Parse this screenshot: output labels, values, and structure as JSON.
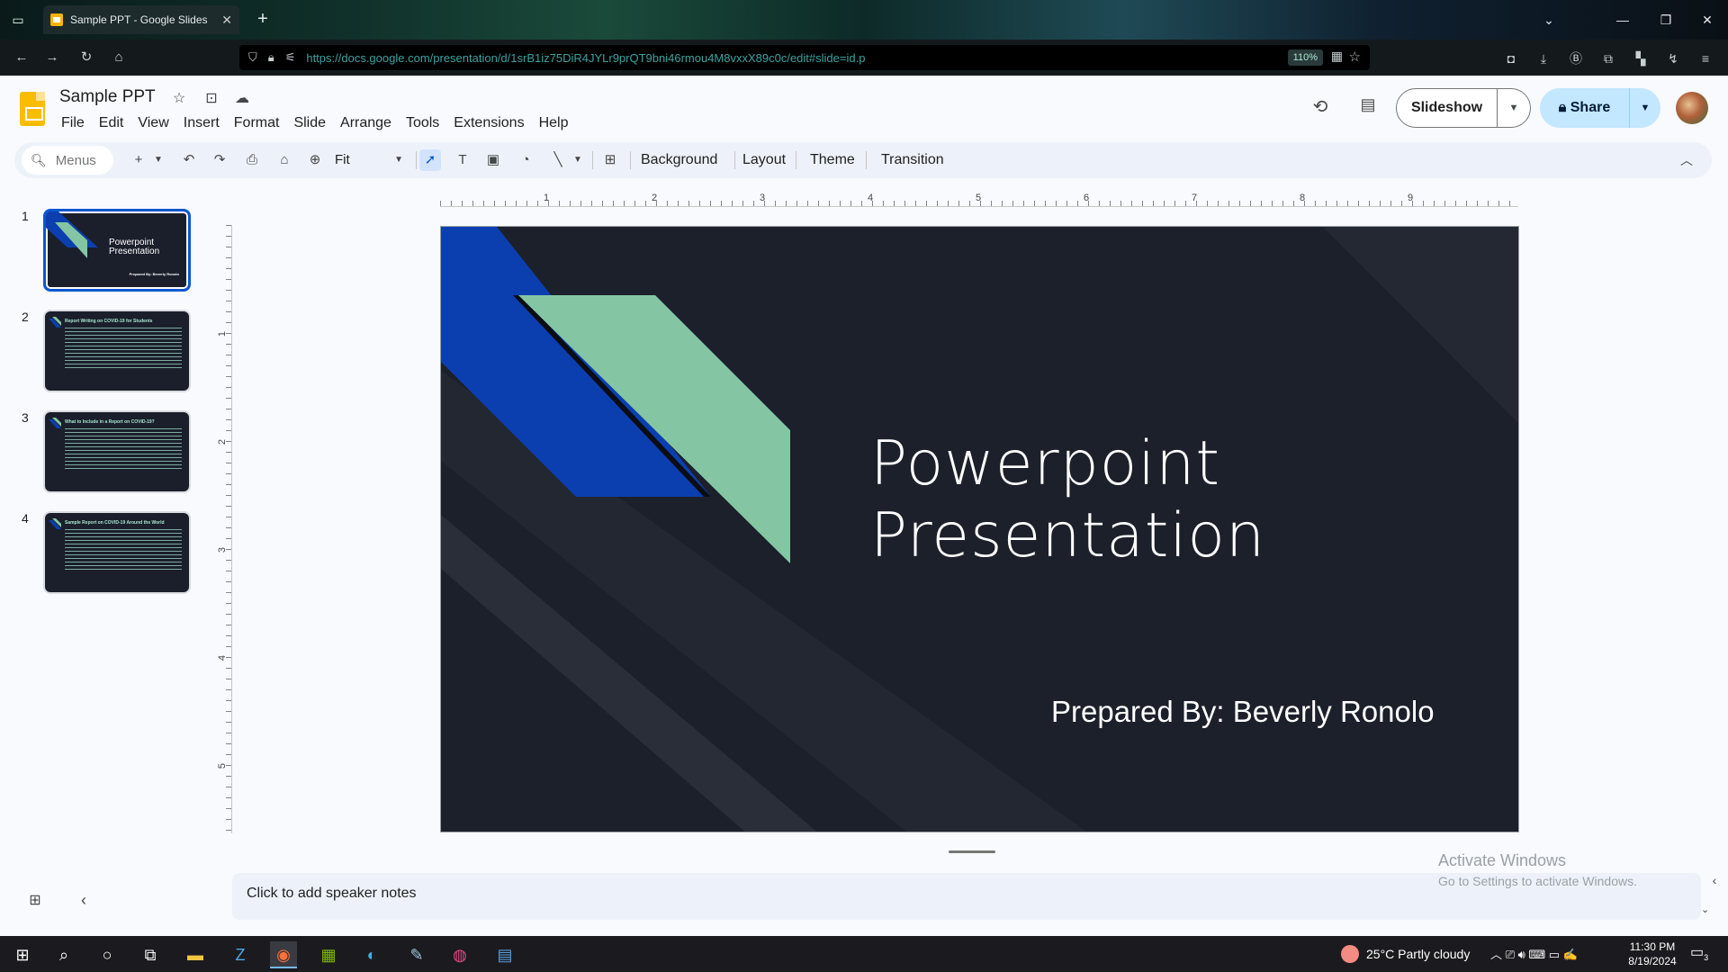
{
  "browser": {
    "tab_title": "Sample PPT - Google Slides",
    "url": "https://docs.google.com/presentation/d/1srB1iz75DiR4JYLr9prQT9bni46rmou4M8vxxX89c0c/edit#slide=id.p",
    "zoom": "110%"
  },
  "doc": {
    "title": "Sample PPT",
    "menus": [
      "File",
      "Edit",
      "View",
      "Insert",
      "Format",
      "Slide",
      "Arrange",
      "Tools",
      "Extensions",
      "Help"
    ],
    "slideshow_label": "Slideshow",
    "share_label": "Share"
  },
  "toolbar": {
    "search_placeholder": "Menus",
    "zoom_value": "Fit",
    "background_label": "Background",
    "layout_label": "Layout",
    "theme_label": "Theme",
    "transition_label": "Transition"
  },
  "ruler": {
    "horizontal": [
      "1",
      "2",
      "3",
      "4",
      "5",
      "6",
      "7",
      "8",
      "9"
    ],
    "vertical": [
      "1",
      "2",
      "3",
      "4",
      "5"
    ]
  },
  "filmstrip": [
    {
      "number": "1",
      "title": "Powerpoint Presentation",
      "byline": "Prepared By: Beverly Ronolo"
    },
    {
      "number": "2",
      "title": "Report Writing on COVID-19 for Students"
    },
    {
      "number": "3",
      "title": "What to Include in a Report on COVID-19?"
    },
    {
      "number": "4",
      "title": "Sample Report on COVID-19 Around the World"
    }
  ],
  "slide": {
    "title_line1": "Powerpoint",
    "title_line2": "Presentation",
    "byline": "Prepared By: Beverly Ronolo",
    "colors": {
      "background": "#1c202b",
      "blue": "#0b3fb0",
      "green": "#84c6a4"
    }
  },
  "notes": {
    "placeholder": "Click to add speaker notes"
  },
  "watermark": {
    "line1": "Activate Windows",
    "line2": "Go to Settings to activate Windows."
  },
  "taskbar": {
    "weather": "25°C  Partly cloudy",
    "time": "11:30 PM",
    "date": "8/19/2024",
    "notification_count": "3"
  }
}
